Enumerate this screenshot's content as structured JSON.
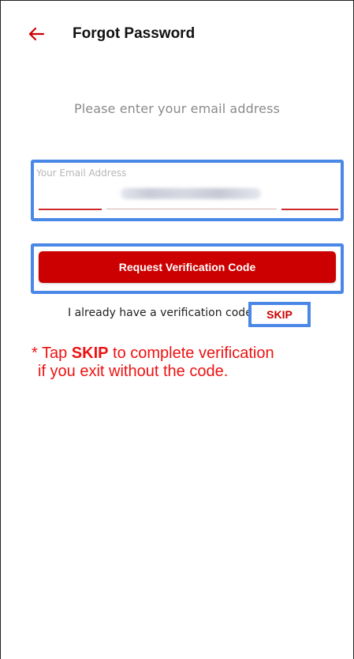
{
  "header": {
    "back_icon": "arrow-left-icon",
    "title": "Forgot Password"
  },
  "prompt": "Please enter your email address",
  "email": {
    "label": "Your Email Address",
    "value": "••••••••••••••••••"
  },
  "request_button_label": "Request Verification Code",
  "already": {
    "text": "I already have a verification code",
    "skip_label": "SKIP"
  },
  "note": {
    "prefix": "* Tap ",
    "skip": "SKIP",
    "line1_suffix": " to complete verification",
    "line2": "if you exit without the code."
  },
  "colors": {
    "accent": "#cc0000",
    "highlight_box": "#4a88e8",
    "note_text": "#ee1111"
  }
}
